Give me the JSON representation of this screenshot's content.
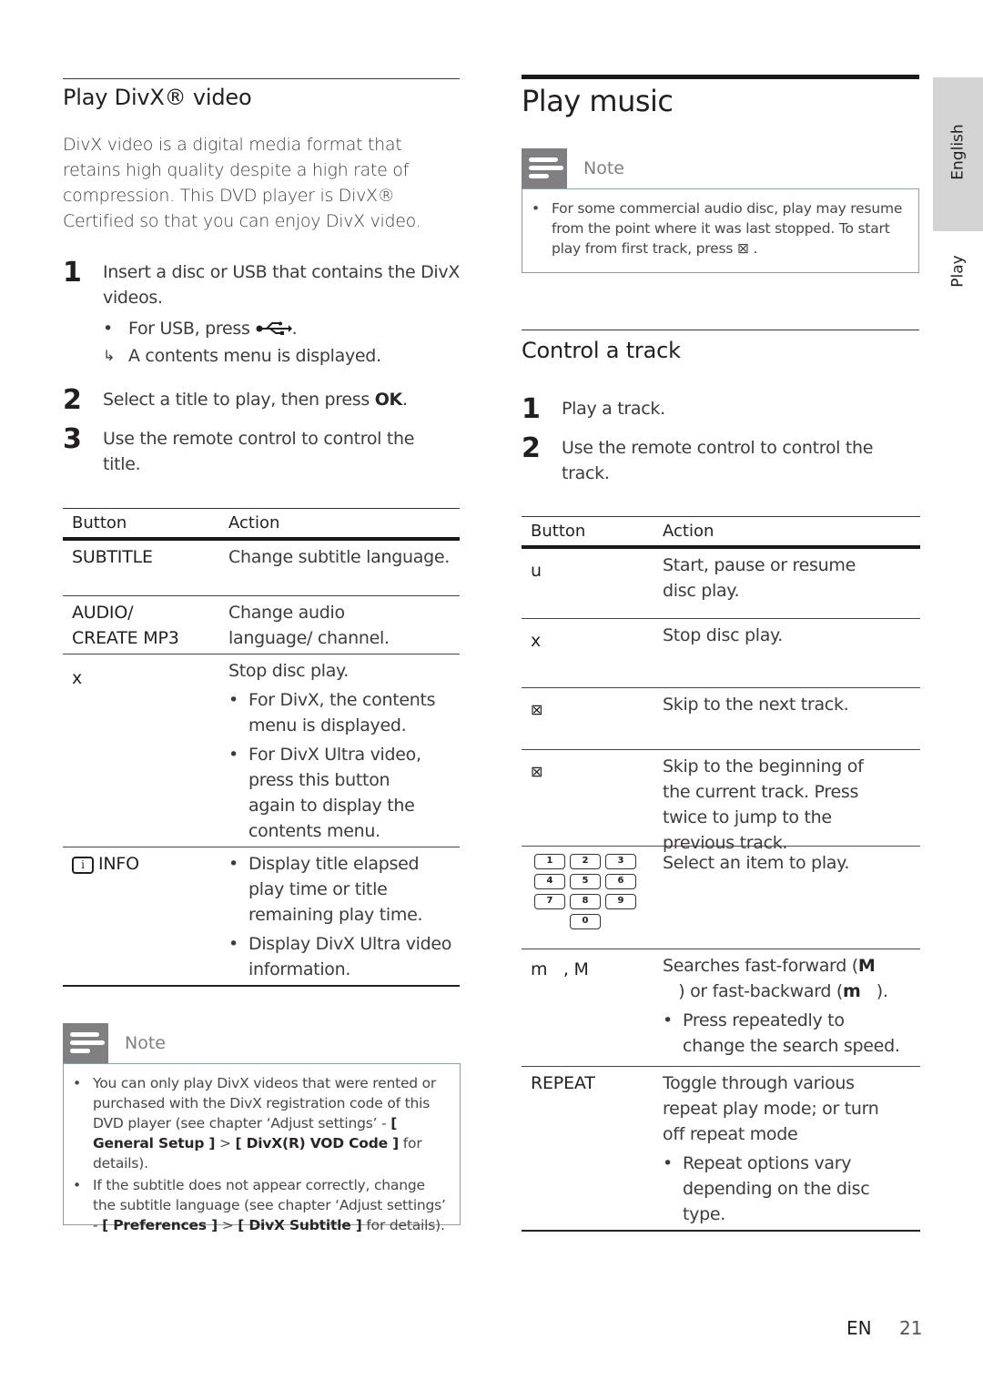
{
  "side_tabs": {
    "language": "English",
    "chapter": "Play"
  },
  "footer": {
    "lang_code": "EN",
    "page_number": "21"
  },
  "divx": {
    "title": "Play DivX® video",
    "intro": "DivX video is a digital media format that retains high quality despite a high rate of compression. This DVD player is DivX® Certified so that you can enjoy DivX video.",
    "steps": [
      {
        "num": "1",
        "text": "Insert a disc or USB that contains the DivX videos.",
        "bullet": "For USB, press",
        "usb_icon": "usb-icon",
        "result": "A contents menu is displayed."
      },
      {
        "num": "2",
        "text": "Select a title to play, then press ",
        "bold": "OK",
        "tail": "."
      },
      {
        "num": "3",
        "text": "Use the remote control to control the title."
      }
    ],
    "table": {
      "headers": [
        "Button",
        "Action"
      ],
      "rows": [
        {
          "button": "SUBTITLE",
          "action": "Change subtitle language.",
          "bullets": []
        },
        {
          "button": "AUDIO/ CREATE MP3",
          "action": "Change audio language/ channel.",
          "bullets": []
        },
        {
          "button": "x",
          "action": "Stop disc play.",
          "bullets": [
            "For DivX, the contents menu is displayed.",
            "For DivX Ultra video, press this button again to display the contents menu."
          ]
        },
        {
          "button": "INFO",
          "button_icon": "info-icon",
          "action": "",
          "bullets": [
            "Display title elapsed play time or title remaining play time.",
            "Display DivX Ultra video information."
          ]
        }
      ]
    },
    "note": {
      "label": "Note",
      "items": [
        {
          "pre": "You can only play DivX videos that were rented or purchased with the DivX registration code of this DVD player (see chapter ‘Adjust settings’ - ",
          "b1": "[ General Setup ]",
          "mid": " > ",
          "b2": "[ DivX(R) VOD Code ]",
          "post": " for details)."
        },
        {
          "pre": "If the subtitle does not appear correctly, change the subtitle language (see chapter ‘Adjust settings’ - ",
          "b1": "[ Preferences ]",
          "mid": " > ",
          "b2": "[ DivX Subtitle ]",
          "post": " for details)."
        }
      ]
    }
  },
  "music": {
    "title": "Play music",
    "note": {
      "label": "Note",
      "text": "For some commercial audio disc, play may resume from the point where it was last stopped. To start play from first track, press",
      "glyph": "⊠",
      "tail": " ."
    },
    "control": {
      "title": "Control a track",
      "steps": [
        {
          "num": "1",
          "text": "Play a track."
        },
        {
          "num": "2",
          "text": "Use the remote control to control the track."
        }
      ],
      "table": {
        "headers": [
          "Button",
          "Action"
        ],
        "rows": [
          {
            "button": "u",
            "action": "Start, pause or resume disc play.",
            "bullets": []
          },
          {
            "button": "x",
            "action": "Stop disc play.",
            "bullets": []
          },
          {
            "button": "⊠",
            "action": "Skip to the next track.",
            "bullets": []
          },
          {
            "button": "⊠",
            "action": "Skip to the beginning of the current track. Press twice to jump to the previous track.",
            "bullets": []
          },
          {
            "button_keys": [
              "1",
              "2",
              "3",
              "4",
              "5",
              "6",
              "7",
              "8",
              "9",
              "0"
            ],
            "action": "Select an item to play.",
            "bullets": []
          },
          {
            "button": "m   , M",
            "action_pre": "Searches fast-forward (",
            "action_b1": "M",
            "action_mid": "   ) or fast-backward (",
            "action_b2": "m",
            "action_post": "   ).",
            "bullets": [
              "Press repeatedly to change the search speed."
            ]
          },
          {
            "button": "REPEAT",
            "action": "Toggle through various repeat play mode; or turn off repeat mode",
            "bullets": [
              "Repeat options vary depending on the disc type."
            ]
          }
        ]
      }
    }
  }
}
